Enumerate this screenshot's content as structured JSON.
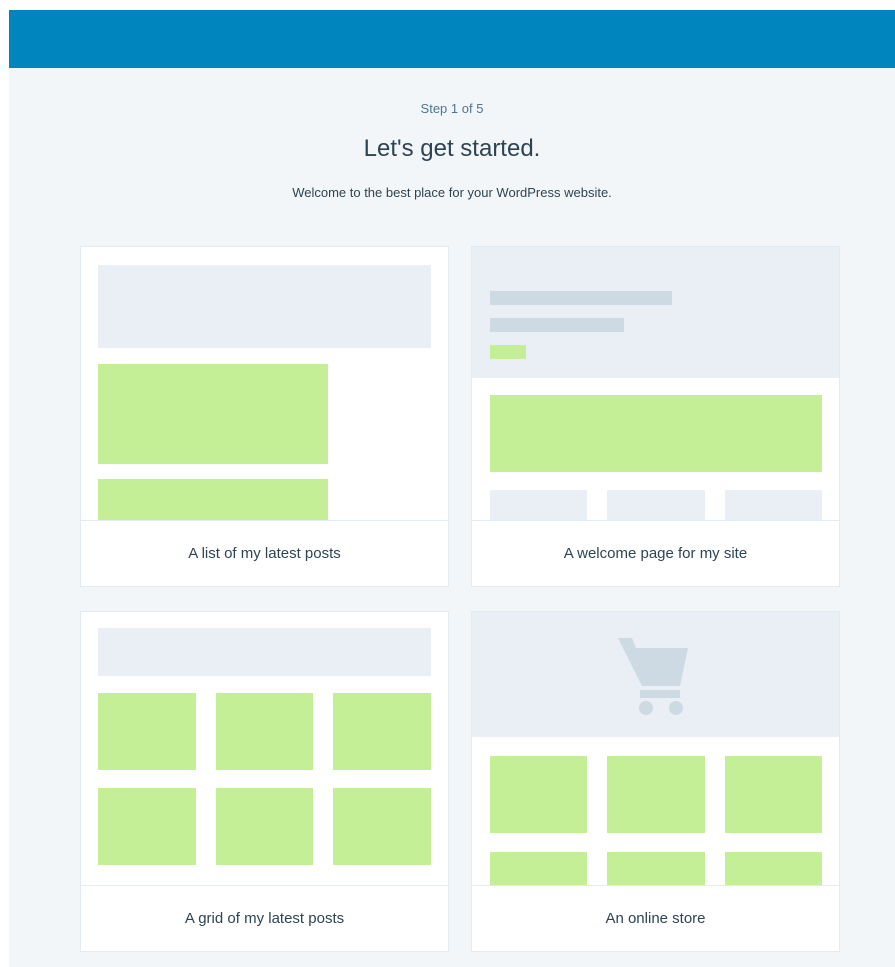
{
  "header": {
    "step": "Step 1 of 5",
    "title": "Let's get started.",
    "subtitle": "Welcome to the best place for your WordPress website."
  },
  "options": [
    {
      "label": "A list of my latest posts"
    },
    {
      "label": "A welcome page for my site"
    },
    {
      "label": "A grid of my latest posts"
    },
    {
      "label": "An online store"
    }
  ],
  "colors": {
    "top_bar": "#0085be",
    "background": "#f3f6f8",
    "placeholder_gray": "#e9eff5",
    "placeholder_green": "#c4ef96",
    "text": "#2e4453"
  },
  "icons": {
    "store_preview": "shopping-cart-icon"
  }
}
